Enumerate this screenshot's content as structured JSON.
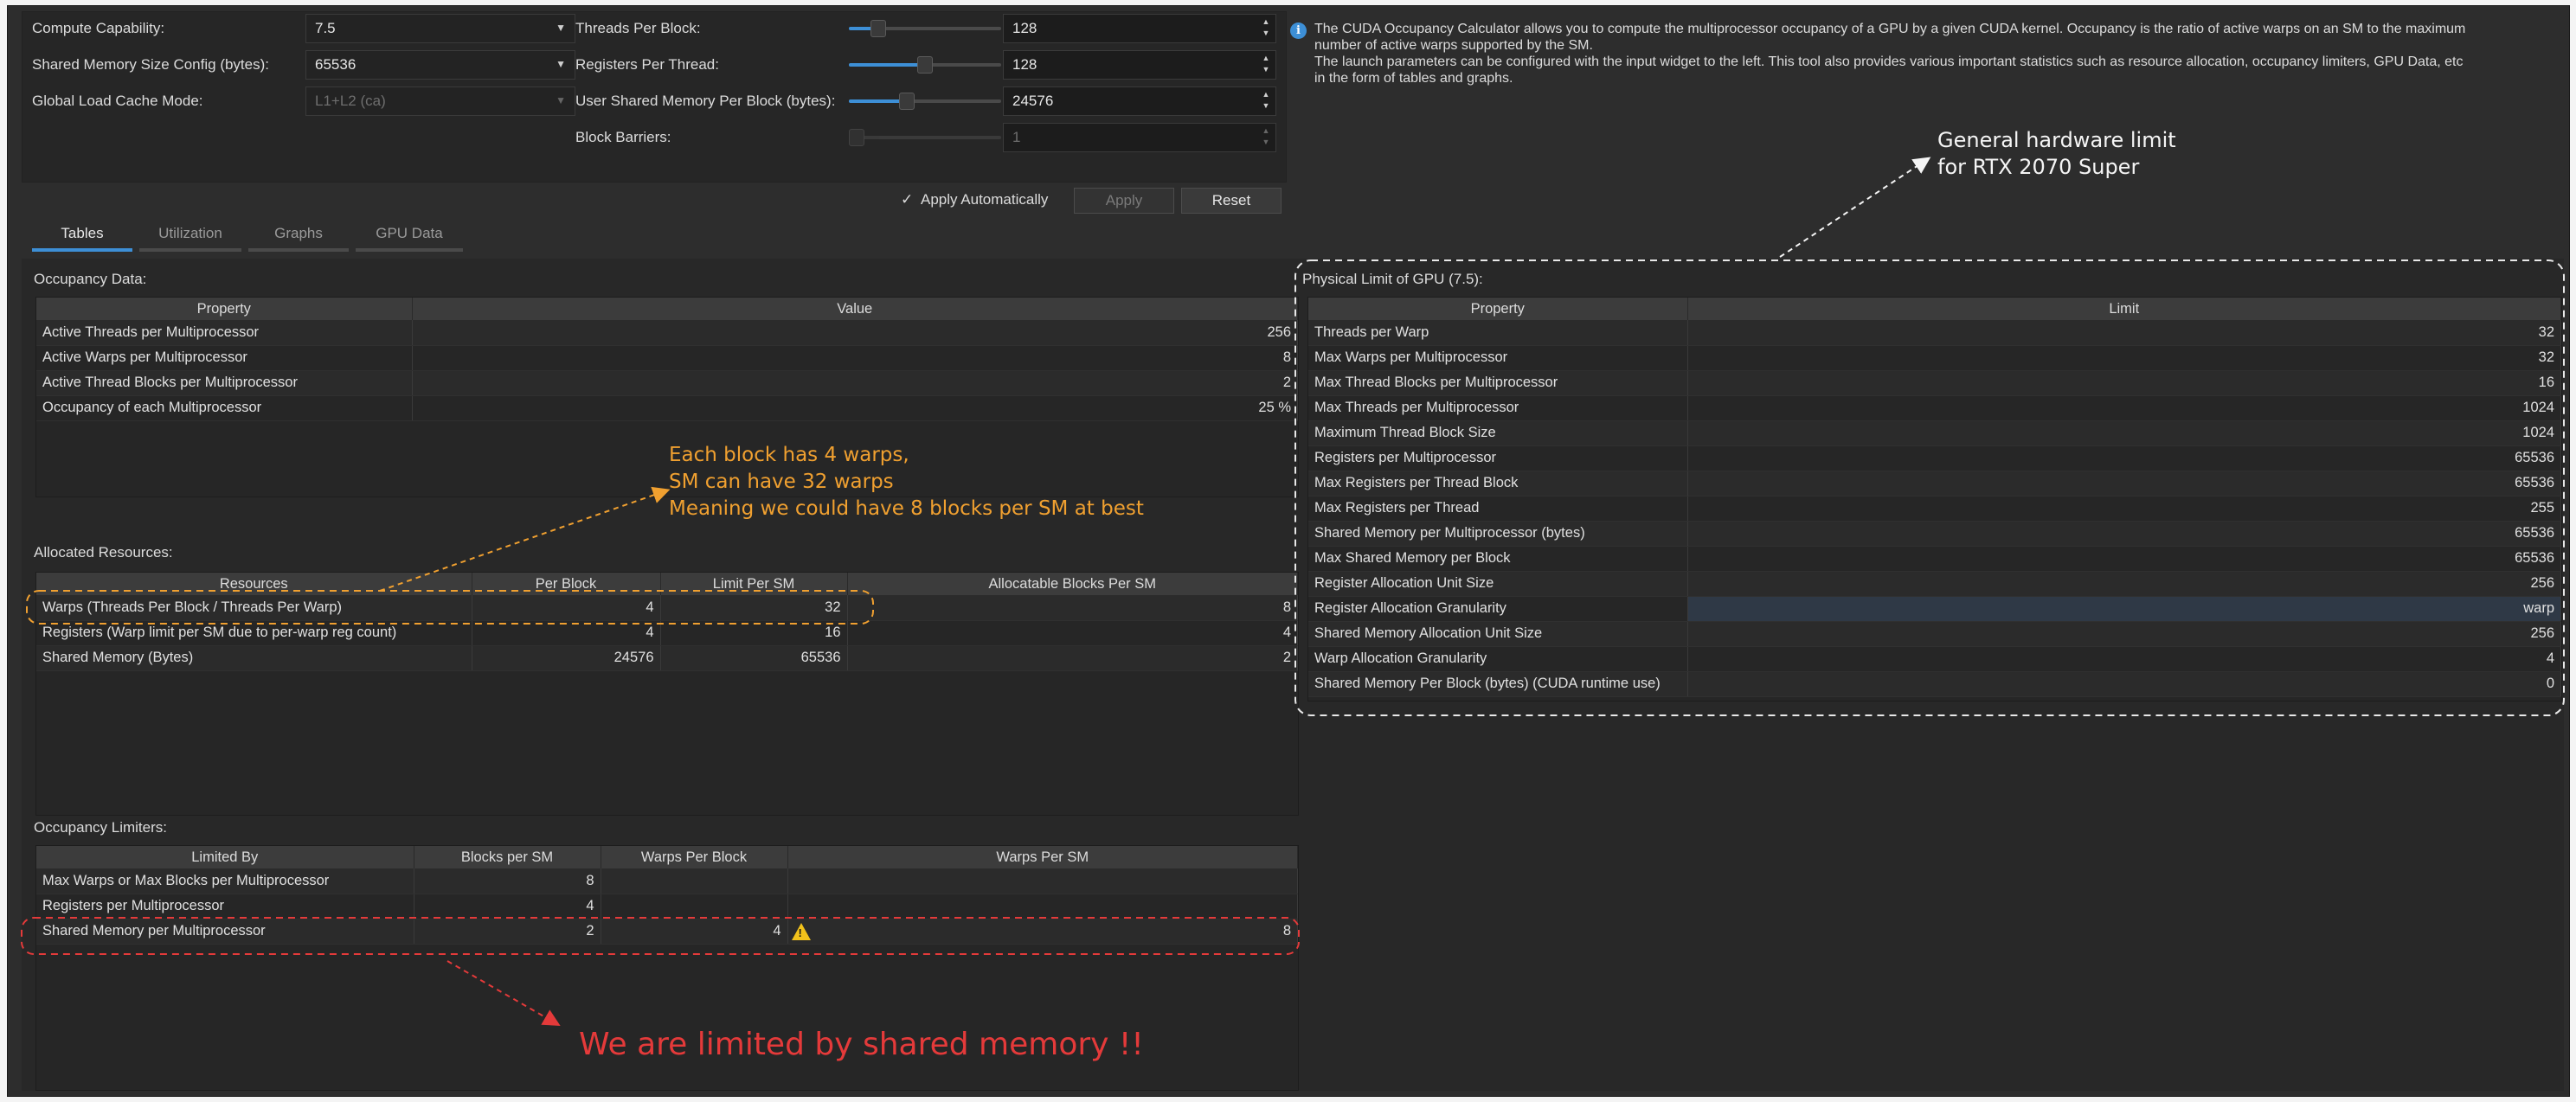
{
  "params_left": [
    {
      "label": "Compute Capability:",
      "value": "7.5",
      "disabled": false
    },
    {
      "label": "Shared Memory Size Config (bytes):",
      "value": "65536",
      "disabled": false
    },
    {
      "label": "Global Load Cache Mode:",
      "value": "L1+L2 (ca)",
      "disabled": true
    }
  ],
  "params_right": [
    {
      "label": "Threads Per Block:",
      "value": "128",
      "level": 0.16,
      "disabled": false
    },
    {
      "label": "Registers Per Thread:",
      "value": "128",
      "level": 0.5,
      "disabled": false
    },
    {
      "label": "User Shared Memory Per Block (bytes):",
      "value": "24576",
      "level": 0.37,
      "disabled": false
    },
    {
      "label": "Block Barriers:",
      "value": "1",
      "level": 0.0,
      "disabled": true
    }
  ],
  "actions": {
    "apply_auto_label": "Apply Automatically",
    "apply_auto_checked": true,
    "apply_label": "Apply",
    "reset_label": "Reset"
  },
  "tabs": [
    {
      "label": "Tables",
      "active": true
    },
    {
      "label": "Utilization",
      "active": false
    },
    {
      "label": "Graphs",
      "active": false
    },
    {
      "label": "GPU Data",
      "active": false
    }
  ],
  "info": {
    "line1": "The CUDA Occupancy Calculator allows you to compute the multiprocessor occupancy of a GPU by a given CUDA kernel. Occupancy is the ratio of active warps on an SM to the maximum",
    "line2": "number of active warps supported by the SM.",
    "line3": "The launch parameters can be configured with the input widget to the left. This tool also provides various important statistics such as resource allocation, occupancy limiters, GPU Data, etc",
    "line4": "in the form of tables and graphs."
  },
  "occupancy": {
    "title": "Occupancy Data:",
    "headers": [
      "Property",
      "Value"
    ],
    "rows": [
      [
        "Active Threads per Multiprocessor",
        "256"
      ],
      [
        "Active Warps per Multiprocessor",
        "8"
      ],
      [
        "Active Thread Blocks per Multiprocessor",
        "2"
      ],
      [
        "Occupancy of each Multiprocessor",
        "25 %"
      ]
    ]
  },
  "allocated": {
    "title": "Allocated Resources:",
    "headers": [
      "Resources",
      "Per Block",
      "Limit Per SM",
      "Allocatable Blocks Per SM"
    ],
    "rows": [
      [
        "Warps (Threads Per Block / Threads Per Warp)",
        "4",
        "32",
        "8"
      ],
      [
        "Registers (Warp limit per SM due to per-warp reg count)",
        "4",
        "16",
        "4"
      ],
      [
        "Shared Memory (Bytes)",
        "24576",
        "65536",
        "2"
      ]
    ]
  },
  "limiters": {
    "title": "Occupancy Limiters:",
    "headers": [
      "Limited By",
      "Blocks per SM",
      "Warps Per Block",
      "Warps Per SM"
    ],
    "rows": [
      [
        "Max Warps or Max Blocks per Multiprocessor",
        "8",
        "",
        ""
      ],
      [
        "Registers per Multiprocessor",
        "4",
        "",
        ""
      ],
      [
        "Shared Memory per Multiprocessor",
        "2",
        "4",
        "8"
      ]
    ]
  },
  "physical": {
    "title": "Physical Limit of GPU (7.5):",
    "headers": [
      "Property",
      "Limit"
    ],
    "rows": [
      [
        "Threads per Warp",
        "32"
      ],
      [
        "Max Warps per Multiprocessor",
        "32"
      ],
      [
        "Max Thread Blocks per Multiprocessor",
        "16"
      ],
      [
        "Max Threads per Multiprocessor",
        "1024"
      ],
      [
        "Maximum Thread Block Size",
        "1024"
      ],
      [
        "Registers per Multiprocessor",
        "65536"
      ],
      [
        "Max Registers per Thread Block",
        "65536"
      ],
      [
        "Max Registers per Thread",
        "255"
      ],
      [
        "Shared Memory per Multiprocessor (bytes)",
        "65536"
      ],
      [
        "Max Shared Memory per Block",
        "65536"
      ],
      [
        "Register Allocation Unit Size",
        "256"
      ],
      [
        "Register Allocation Granularity",
        "warp"
      ],
      [
        "Shared Memory Allocation Unit Size",
        "256"
      ],
      [
        "Warp Allocation Granularity",
        "4"
      ],
      [
        "Shared Memory Per Block (bytes) (CUDA runtime use)",
        "0"
      ]
    ]
  },
  "annotations": {
    "hw_line1": "General hardware limit",
    "hw_line2": "for RTX 2070 Super",
    "warps_line1": "Each block has 4 warps,",
    "warps_line2": "SM can have 32 warps",
    "warps_line3": "Meaning we could have 8 blocks per SM at best",
    "limit_text": "We are limited by shared memory !!"
  },
  "colors": {
    "accent": "#3d8fd6",
    "annot_orange": "#f0a030",
    "annot_red": "#e43a3a",
    "warning": "#f2c21b"
  },
  "icons": {
    "info": "info-icon",
    "warning": "warning-icon",
    "check": "checkmark-icon"
  }
}
